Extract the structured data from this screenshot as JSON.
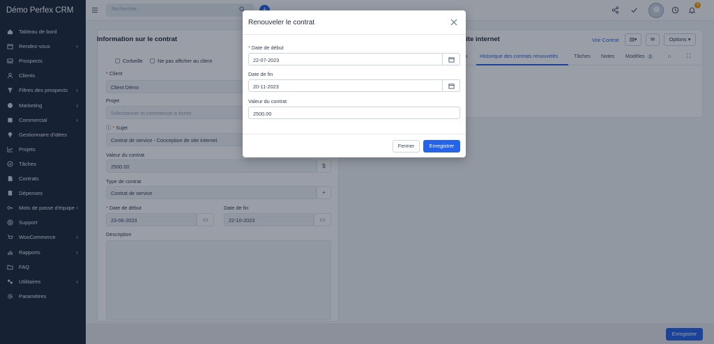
{
  "app": {
    "title": "Démo Perfex CRM"
  },
  "topbar": {
    "search_placeholder": "Rechercher...",
    "notification_count": "3"
  },
  "sidebar": {
    "items": [
      {
        "label": "Tableau de bord",
        "icon": "home-icon",
        "has_children": false
      },
      {
        "label": "Rendez-vous",
        "icon": "calendar-icon",
        "has_children": true
      },
      {
        "label": "Prospects",
        "icon": "inbox-icon",
        "has_children": false
      },
      {
        "label": "Clients",
        "icon": "user-icon",
        "has_children": false
      },
      {
        "label": "Filtres des prospects",
        "icon": "filter-icon",
        "has_children": true
      },
      {
        "label": "Marketing",
        "icon": "globe-icon",
        "has_children": true
      },
      {
        "label": "Commercial",
        "icon": "tag-icon",
        "has_children": true
      },
      {
        "label": "Gestionnaire d'idées",
        "icon": "lightbulb-icon",
        "has_children": false
      },
      {
        "label": "Projets",
        "icon": "chart-icon",
        "has_children": false
      },
      {
        "label": "Tâches",
        "icon": "check-circle-icon",
        "has_children": false
      },
      {
        "label": "Contrats",
        "icon": "document-icon",
        "has_children": false
      },
      {
        "label": "Dépenses",
        "icon": "receipt-icon",
        "has_children": false
      },
      {
        "label": "Mots de passe d'équipe",
        "icon": "key-icon",
        "has_children": true
      },
      {
        "label": "Support",
        "icon": "lifebuoy-icon",
        "has_children": false
      },
      {
        "label": "WooCommerce",
        "icon": "cart-icon",
        "has_children": true
      },
      {
        "label": "Rapports",
        "icon": "bar-chart-icon",
        "has_children": true
      },
      {
        "label": "FAQ",
        "icon": "folder-icon",
        "has_children": false
      },
      {
        "label": "Utilitaires",
        "icon": "toggle-icon",
        "has_children": true
      },
      {
        "label": "Paramètres",
        "icon": "cog-icon",
        "has_children": false
      }
    ]
  },
  "contract_form": {
    "title": "Information sur le contrat",
    "trash_label": "Corbeille",
    "hide_client_label": "Ne pas afficher au client",
    "client_label": "Client",
    "client_value": "Client Démo",
    "project_label": "Projet",
    "project_placeholder": "Sélectionner et commencer à écrire",
    "subject_label": "Sujet",
    "subject_value": "Contrat de service - Conception de site internet",
    "value_label": "Valeur du contrat",
    "value_value": "2500.00",
    "currency_symbol": "$",
    "type_label": "Type de contrat",
    "type_value": "Contrat de service",
    "start_label": "Date de début",
    "start_value": "23-06-2023",
    "end_label": "Date de fin",
    "end_value": "22-10-2023",
    "description_label": "Description"
  },
  "right_panel": {
    "title_fragment": "site internet",
    "view_contract": "Voir Contrat",
    "options": "Options",
    "tabs": [
      {
        "label": "es",
        "active": false
      },
      {
        "label": "Historique des contrats renouvelés",
        "active": true
      },
      {
        "label": "Tâches",
        "active": false
      },
      {
        "label": "Notes",
        "active": false
      },
      {
        "label": "Modèles",
        "active": false,
        "badge": "2"
      }
    ]
  },
  "modal": {
    "title": "Renouveler le contrat",
    "start_label": "Date de début",
    "start_value": "22-07-2023",
    "end_label": "Date de fin",
    "end_value": "20-11-2023",
    "value_label": "Valeur du contrat",
    "value_value": "2500.00",
    "close_button": "Fermer",
    "save_button": "Enregistrer"
  },
  "footer": {
    "save_button": "Enregistrer"
  },
  "colors": {
    "primary": "#2563eb",
    "sidebar": "#1e293b",
    "required": "#ef4444",
    "badge": "#f59e0b"
  }
}
